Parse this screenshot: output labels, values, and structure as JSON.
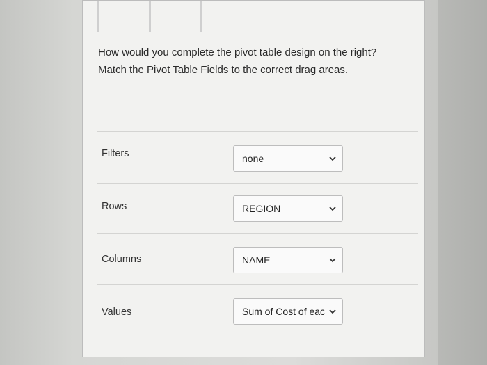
{
  "question": {
    "line1": "How would you complete the pivot table design on the right?",
    "line2": "Match the Pivot Table Fields to the correct drag areas."
  },
  "rows": [
    {
      "label": "Filters",
      "selected": "none"
    },
    {
      "label": "Rows",
      "selected": "REGION"
    },
    {
      "label": "Columns",
      "selected": "NAME"
    },
    {
      "label": "Values",
      "selected": "Sum of Cost of eac"
    }
  ],
  "colors": {
    "page": "#f2f2f0",
    "text": "#2b2b2b",
    "border": "#bdbdbd"
  },
  "icons": {
    "dropdown": "chevron-down-icon"
  }
}
